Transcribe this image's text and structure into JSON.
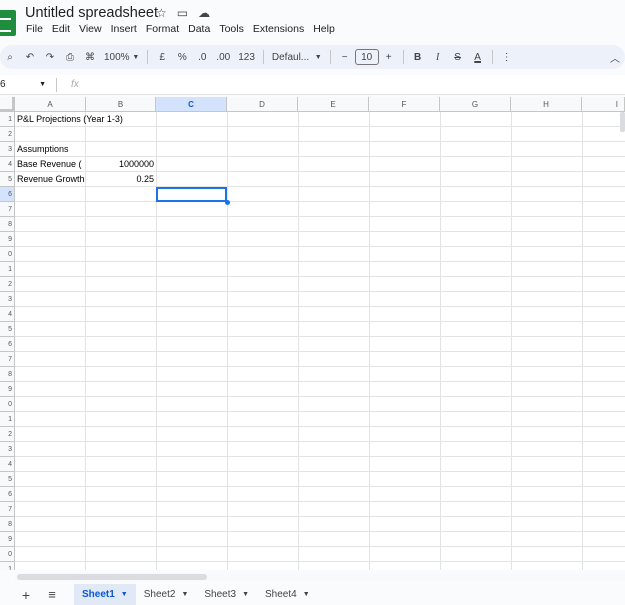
{
  "app": {
    "title": "Untitled spreadsheet"
  },
  "menu": [
    "File",
    "Edit",
    "View",
    "Insert",
    "Format",
    "Data",
    "Tools",
    "Extensions",
    "Help"
  ],
  "toolbar": {
    "zoom": "100%",
    "currency": "£",
    "percent": "%",
    "dec_less": ".0",
    "dec_more": ".00",
    "number_format": "123",
    "font": "Defaul...",
    "font_size": "10",
    "bold": "B",
    "italic": "I",
    "text_color": "A"
  },
  "formula_bar": {
    "name_box": "6",
    "fx": "fx"
  },
  "columns": [
    "A",
    "B",
    "C",
    "D",
    "E",
    "F",
    "G",
    "H",
    "I"
  ],
  "rows": [
    "1",
    "2",
    "3",
    "4",
    "5",
    "6",
    "7",
    "8",
    "9",
    "0",
    "1",
    "2",
    "3",
    "4",
    "5",
    "6",
    "7",
    "8",
    "9",
    "0",
    "1",
    "2",
    "3",
    "4",
    "5",
    "6",
    "7",
    "8",
    "9",
    "0",
    "1"
  ],
  "cells": {
    "a1": "P&L Projections (Year 1-3)",
    "a3": "Assumptions",
    "a4": "Base Revenue (",
    "b4": "1000000",
    "a5": "Revenue Growth",
    "b5": "0.25"
  },
  "sheets": [
    "Sheet1",
    "Sheet2",
    "Sheet3",
    "Sheet4"
  ],
  "colors": {
    "accent": "#1a73e8",
    "brand": "#1e8e3e"
  }
}
